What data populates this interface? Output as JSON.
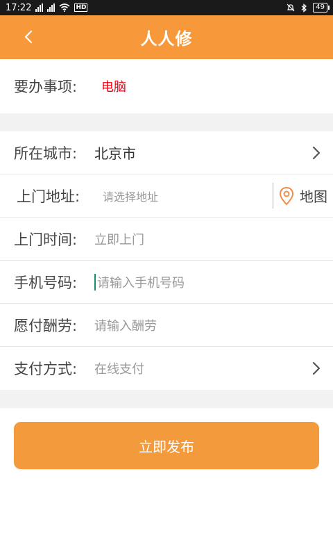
{
  "status_bar": {
    "time": "17:22",
    "network": "4G",
    "hd": "HD",
    "battery": "49"
  },
  "header": {
    "title": "人人修",
    "back_icon": "chevron-left-icon"
  },
  "form": {
    "service": {
      "label": "要办事项:",
      "value": "电脑"
    },
    "city": {
      "label": "所在城市:",
      "value": "北京市"
    },
    "address": {
      "label": "上门地址:",
      "placeholder": "请选择地址",
      "map_label": "地图"
    },
    "time": {
      "label": "上门时间:",
      "value": "立即上门"
    },
    "phone": {
      "label": "手机号码:",
      "placeholder": "请输入手机号码"
    },
    "fee": {
      "label": "愿付酬劳:",
      "placeholder": "请输入酬劳"
    },
    "payment": {
      "label": "支付方式:",
      "value": "在线支付"
    }
  },
  "actions": {
    "publish_label": "立即发布"
  },
  "colors": {
    "accent": "#f7993a",
    "button": "#f39a3d",
    "highlight_text": "#e60012"
  }
}
